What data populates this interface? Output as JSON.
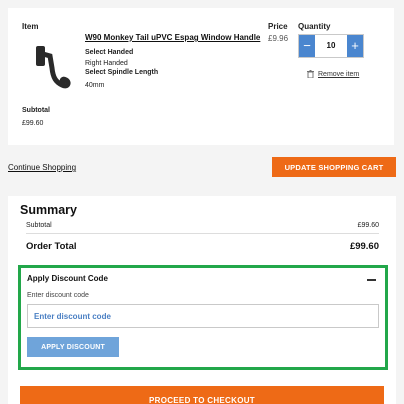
{
  "cart": {
    "headers": {
      "item": "Item",
      "price": "Price",
      "quantity": "Quantity"
    },
    "item": {
      "name": "W90 Monkey Tail uPVC Espag Window Handle",
      "options": [
        {
          "label": "Select Handed",
          "value": "Right Handed"
        },
        {
          "label": "Select Spindle Length",
          "value": "40mm"
        }
      ],
      "price": "£9.96",
      "quantity": "10",
      "remove_label": "Remove item",
      "thumbnail_icon": "window-handle-image"
    },
    "subtotal_label": "Subtotal",
    "subtotal_value": "£99.60"
  },
  "actions": {
    "continue_label": "Continue Shopping",
    "update_label": "UPDATE SHOPPING CART"
  },
  "summary": {
    "title": "Summary",
    "subtotal_label": "Subtotal",
    "subtotal_value": "£99.60",
    "order_total_label": "Order Total",
    "order_total_value": "£99.60",
    "discount": {
      "title": "Apply Discount Code",
      "hint": "Enter discount code",
      "placeholder": "Enter discount code",
      "value": "",
      "apply_label": "APPLY DISCOUNT"
    },
    "checkout_label": "PROCEED TO CHECKOUT"
  },
  "colors": {
    "accent_orange": "#ee6a16",
    "stepper_blue": "#4a86cf",
    "apply_blue": "#6fa4da",
    "highlight_green": "#22a74a"
  }
}
